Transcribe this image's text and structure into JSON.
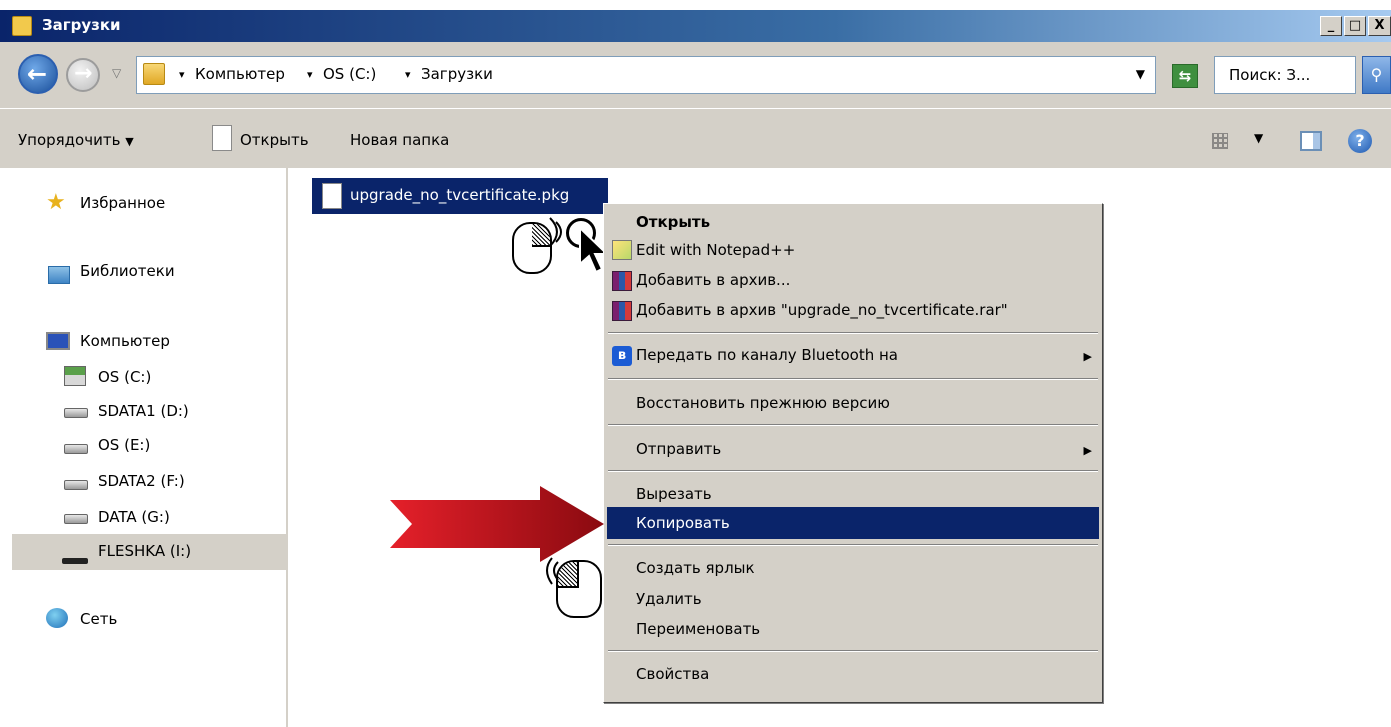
{
  "window": {
    "title": "Загрузки",
    "buttons": [
      "_",
      "□",
      "X"
    ]
  },
  "address": {
    "back": "←",
    "forward": "→",
    "crumbs": [
      "Компьютер",
      "OS (C:)",
      "Загрузки"
    ],
    "separator": "▾",
    "search_placeholder": "Поиск: З..."
  },
  "toolbar": {
    "organize": "Упорядочить",
    "open": "Открыть",
    "new_folder": "Новая папка"
  },
  "nav": {
    "favorites": "Избранное",
    "libraries": "Библиотеки",
    "computer": "Компьютер",
    "drives": [
      "OS (C:)",
      "SDATA1 (D:)",
      "OS (E:)",
      "SDATA2 (F:)",
      "DATA (G:)",
      "FLESHKA (I:)"
    ],
    "network": "Сеть",
    "selected": "FLESHKA (I:)"
  },
  "content": {
    "file_name": "upgrade_no_tvcertificate.pkg"
  },
  "context_menu": {
    "items": [
      "Открыть",
      "Edit with Notepad++",
      "Добавить в архив...",
      "Добавить в архив \"upgrade_no_tvcertificate.rar\"",
      "Передать по каналу Bluetooth на",
      "Восстановить прежнюю версию",
      "Отправить",
      "Вырезать",
      "Копировать",
      "Создать ярлык",
      "Удалить",
      "Переименовать",
      "Свойства"
    ],
    "highlighted": "Копировать",
    "submenu_arrow": "▶"
  },
  "colors": {
    "selection": "#0a246a",
    "chrome": "#d4d0c8",
    "arrow": "#c8141e"
  }
}
